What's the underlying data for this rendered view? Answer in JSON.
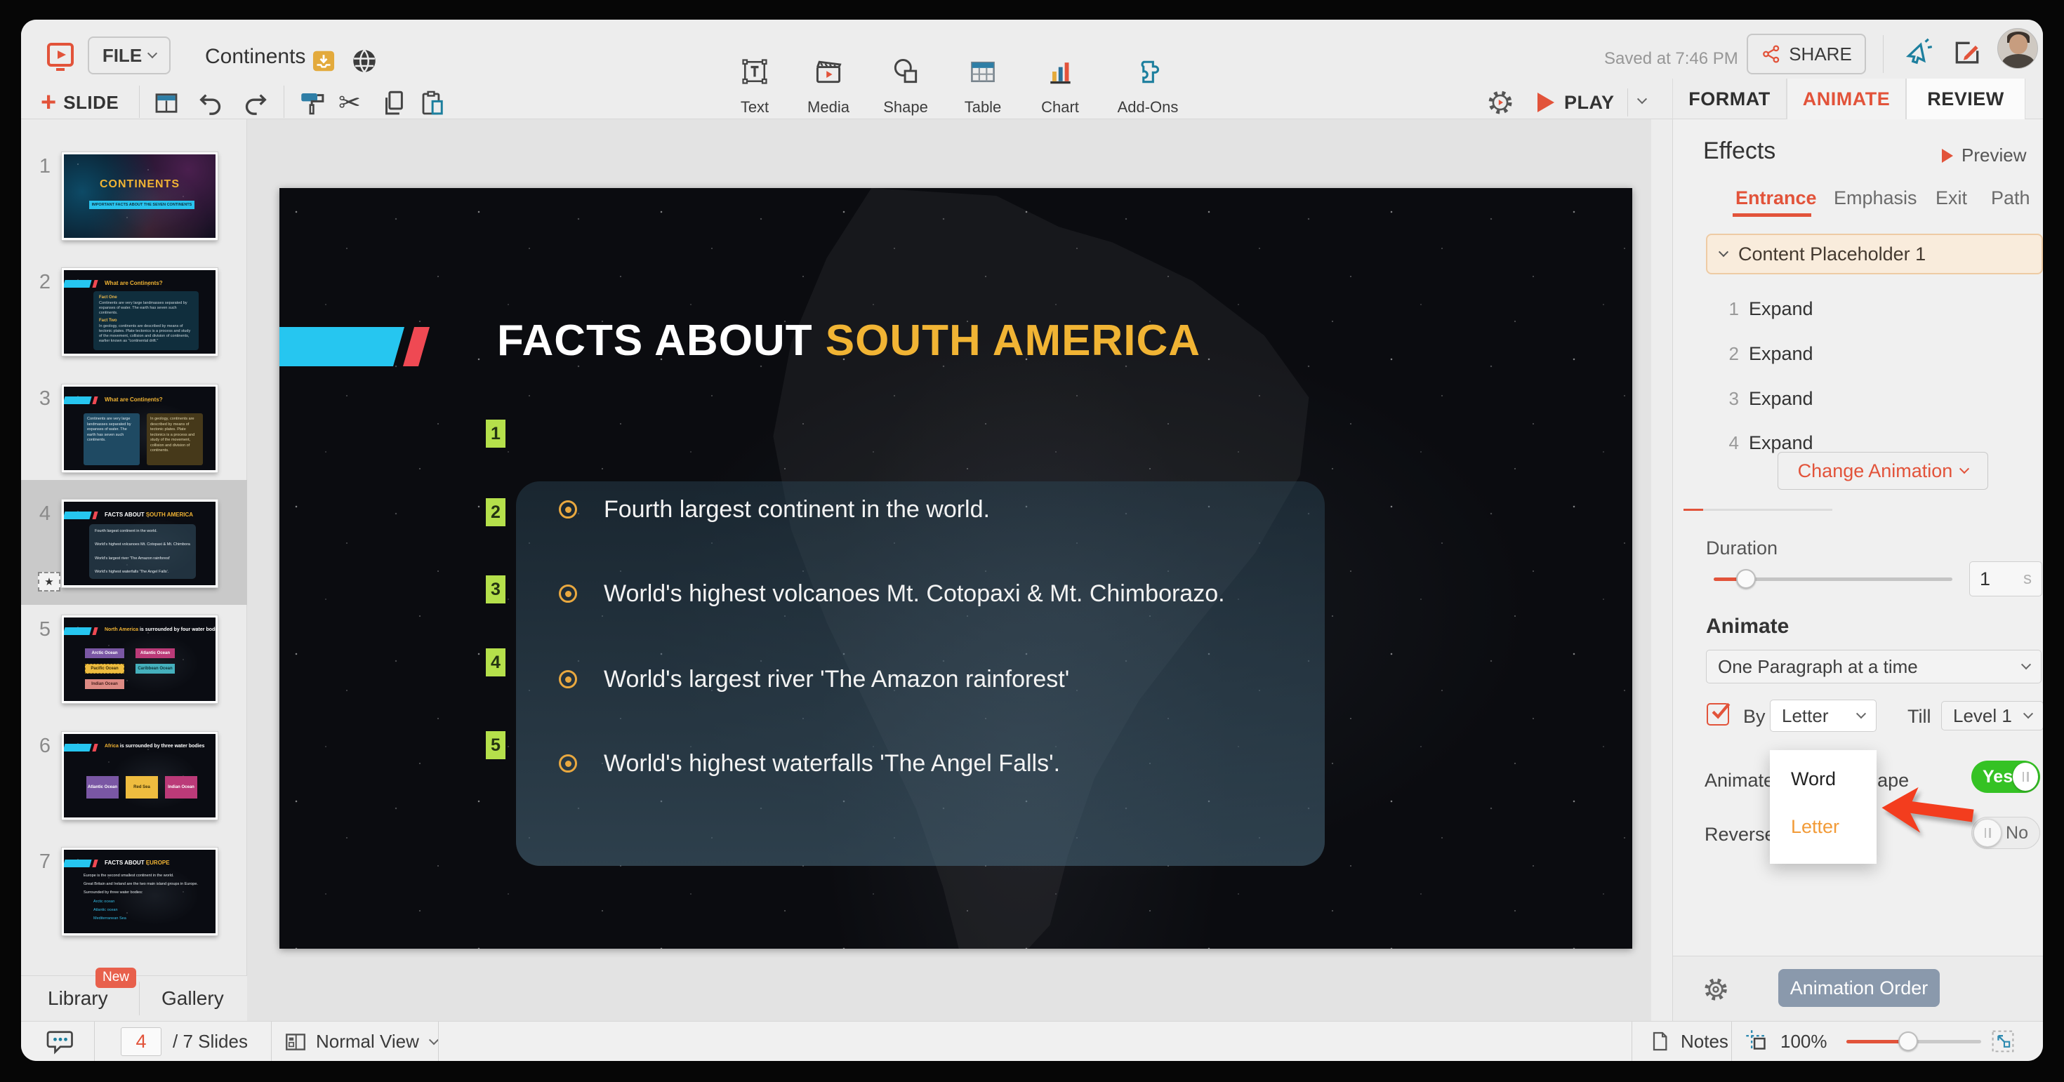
{
  "header": {
    "file_button": "FILE",
    "doc_title": "Continents",
    "saved_status": "Saved at 7:46 PM",
    "share_button": "SHARE",
    "slide_button": "SLIDE",
    "play_button": "PLAY",
    "format_tab": "FORMAT",
    "animate_tab": "ANIMATE",
    "review_tab": "REVIEW",
    "tools": {
      "text": "Text",
      "media": "Media",
      "shape": "Shape",
      "table": "Table",
      "chart": "Chart",
      "addons": "Add-Ons"
    }
  },
  "sidebar": {
    "slides": [
      {
        "num": "1",
        "title": "CONTINENTS",
        "subtitle": "IMPORTANT FACTS ABOUT THE SEVEN CONTINENTS"
      },
      {
        "num": "2",
        "title": "What are Continents?",
        "fact1_label": "Fact One",
        "fact1_text": "Continents are very large landmasses separated by expanses of water. The earth has seven such continents.",
        "fact2_label": "Fact Two",
        "fact2_text": "In geology, continents are described by means of tectonic plates. Plate tectonics is a process and study of the movement, collision and division of continents, earlier known as \"continental drift.\""
      },
      {
        "num": "3",
        "title": "What are Continents?",
        "box1_text": "Continents are very large landmasses separated by expanses of water. The earth has seven such continents.",
        "box2_text": "In geology, continents are described by means of tectonic plates. Plate tectonics is a process and study of the movement, collision and division of continents."
      },
      {
        "num": "4",
        "title_white": "FACTS ABOUT ",
        "title_accent": "SOUTH AMERICA",
        "bullets": [
          "Fourth largest continent in the world.",
          "World's highest volcanoes Mt. Cotopaxi & Mt. Chimborazo.",
          "World's largest river 'The Amazon rainforest'",
          "World's highest waterfalls 'The Angel Falls'."
        ]
      },
      {
        "num": "5",
        "title_accent": "North America",
        "title_rest": "is surrounded by four water bodies:",
        "labels": [
          "Arctic Ocean",
          "Atlantic Ocean",
          "Pacific Ocean",
          "Caribbean Ocean",
          "Indian Ocean"
        ]
      },
      {
        "num": "6",
        "title_accent": "Africa",
        "title_rest": "is surrounded by three water bodies",
        "labels": [
          "Atlantic Ocean",
          "Red Sea",
          "Indian Ocean"
        ]
      },
      {
        "num": "7",
        "title_white": "FACTS ABOUT ",
        "title_accent": "EUROPE",
        "bullets": [
          "Europe is the second smallest continent in the world.",
          "Great Britain and Ireland are the two main island groups in Europe.",
          "Surrounded by three water bodies:"
        ],
        "sub_bullets": [
          "Arctic ocean",
          "Atlantic ocean",
          "Mediterranean Sea"
        ]
      }
    ],
    "library_label": "Library",
    "library_badge": "New",
    "gallery_label": "Gallery"
  },
  "canvas": {
    "title_white": "FACTS ABOUT ",
    "title_accent": "SOUTH AMERICA",
    "badges": [
      "1",
      "2",
      "3",
      "4",
      "5"
    ],
    "bullets": [
      "Fourth largest continent in the world.",
      "World's highest volcanoes Mt. Cotopaxi & Mt. Chimborazo.",
      "World's largest river 'The Amazon rainforest'",
      "World's highest waterfalls 'The Angel Falls'."
    ]
  },
  "panel": {
    "title": "Effects",
    "preview_label": "Preview",
    "tab_entrance": "Entrance",
    "tab_emphasis": "Emphasis",
    "tab_exit": "Exit",
    "tab_path": "Path",
    "placeholder_label": "Content Placeholder 1",
    "effects": [
      {
        "num": "1",
        "name": "Expand"
      },
      {
        "num": "2",
        "name": "Expand"
      },
      {
        "num": "3",
        "name": "Expand"
      },
      {
        "num": "4",
        "name": "Expand"
      }
    ],
    "change_animation_label": "Change Animation",
    "duration_label": "Duration",
    "duration_value": "1",
    "duration_unit": "s",
    "animate_heading": "Animate",
    "paragraph_mode": "One Paragraph at a time",
    "by_label": "By",
    "by_value": "Letter",
    "till_label": "Till",
    "till_value": "Level 1",
    "by_options": [
      "Word",
      "Letter"
    ],
    "animate_shape_label": "Animate attached shape",
    "animate_shape_value": "Yes",
    "reverse_label": "Reverse",
    "reverse_value": "No",
    "animation_order_label": "Animation Order"
  },
  "statusbar": {
    "slide_number": "4",
    "slides_total": "/ 7 Slides",
    "view_mode": "Normal View",
    "notes_label": "Notes",
    "zoom_value": "100%"
  },
  "colors": {
    "accent": "#e2533a",
    "highlight_orange": "#f29b38",
    "toggle_green": "#35c224",
    "badge_green": "#b5e04b",
    "slide_yellow": "#f1b434",
    "cyan": "#26c6f0"
  }
}
